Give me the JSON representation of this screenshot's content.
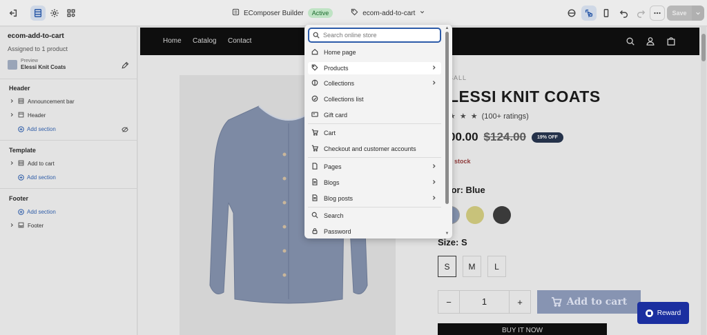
{
  "topbar": {
    "app_name": "EComposer Builder",
    "status_badge": "Active",
    "page_selector": "ecom-add-to-cart",
    "save_label": "Save"
  },
  "sidebar": {
    "title": "ecom-add-to-cart",
    "subtitle": "Assigned to 1 product",
    "preview_label": "Preview",
    "preview_value": "Elessi Knit Coats",
    "sections": {
      "header": {
        "heading": "Header",
        "items": [
          "Announcement bar",
          "Header"
        ],
        "add_label": "Add section"
      },
      "template": {
        "heading": "Template",
        "items": [
          "Add to cart"
        ],
        "add_label": "Add section"
      },
      "footer": {
        "heading": "Footer",
        "add_label": "Add section",
        "items": [
          "Footer"
        ]
      }
    }
  },
  "store": {
    "nav": [
      "Home",
      "Catalog",
      "Contact"
    ],
    "vendor": "SALL",
    "title": "LESSI KNIT COATS",
    "rating_text": "(100+ ratings)",
    "price": "00.00",
    "old_price": "$124.00",
    "discount_badge": "19% OFF",
    "stock": "n stock",
    "color_label": "lor:  Blue",
    "size_label": "Size:  S",
    "sizes": [
      "S",
      "M",
      "L"
    ],
    "quantity": "1",
    "qty_minus": "−",
    "qty_plus": "+",
    "add_to_cart": "Add to cart",
    "buy_now": "BUY IT NOW",
    "reward": "Reward"
  },
  "dropdown": {
    "search_placeholder": "Search online store",
    "items": [
      {
        "label": "Home page",
        "icon": "home-icon",
        "has_arrow": false
      },
      {
        "label": "Products",
        "icon": "tag-icon",
        "has_arrow": true,
        "highlighted": true
      },
      {
        "label": "Collections",
        "icon": "collection-icon",
        "has_arrow": true
      },
      {
        "label": "Collections list",
        "icon": "collection-list-icon",
        "has_arrow": false
      },
      {
        "label": "Gift card",
        "icon": "gift-card-icon",
        "has_arrow": false
      },
      {
        "label": "Cart",
        "icon": "cart-icon",
        "has_arrow": false
      },
      {
        "label": "Checkout and customer accounts",
        "icon": "checkout-icon",
        "has_arrow": false
      },
      {
        "label": "Pages",
        "icon": "page-icon",
        "has_arrow": true
      },
      {
        "label": "Blogs",
        "icon": "blog-icon",
        "has_arrow": true
      },
      {
        "label": "Blog posts",
        "icon": "blog-post-icon",
        "has_arrow": true
      },
      {
        "label": "Search",
        "icon": "search-icon",
        "has_arrow": false
      },
      {
        "label": "Password",
        "icon": "lock-icon",
        "has_arrow": false
      }
    ]
  },
  "colors": {
    "accent": "#2b5aa8",
    "badge_bg": "#bfe3c4",
    "reward_bg": "#1b2fa0",
    "add_to_cart_bg": "#8794b2"
  }
}
